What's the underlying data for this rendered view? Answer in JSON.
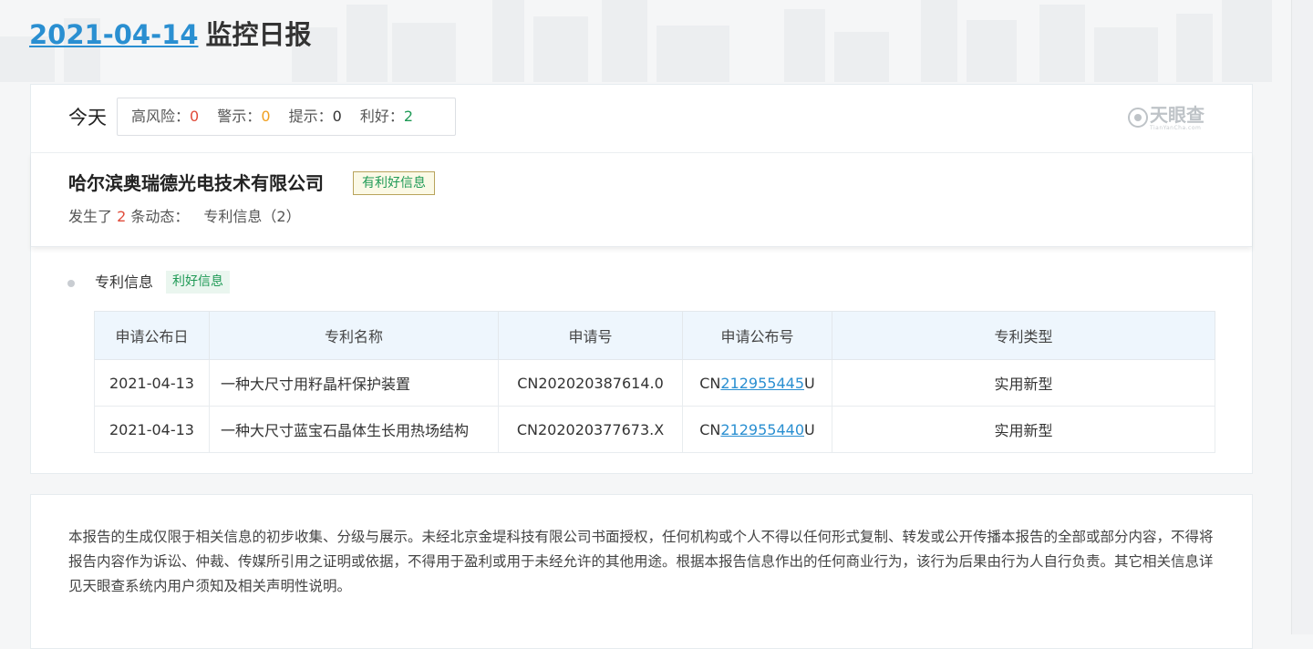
{
  "header": {
    "date": "2021-04-14",
    "title": "监控日报"
  },
  "today": {
    "label": "今天",
    "stats": [
      {
        "label": "高风险：",
        "value": "0",
        "color": "#e04b3a"
      },
      {
        "label": "警示：",
        "value": "0",
        "color": "#f0a020"
      },
      {
        "label": "提示：",
        "value": "0",
        "color": "#333333"
      },
      {
        "label": "利好：",
        "value": "2",
        "color": "#1f9a56"
      }
    ]
  },
  "logo": {
    "name": "天眼查",
    "sub": "TianYanCha.com"
  },
  "company": {
    "name": "哈尔滨奥瑞德光电技术有限公司",
    "tag": "有利好信息",
    "summary_prefix": "发生了",
    "summary_count": "2",
    "summary_suffix": "条动态：",
    "summary_items": "专利信息（2）"
  },
  "section": {
    "title": "专利信息",
    "tag": "利好信息"
  },
  "table": {
    "columns": [
      "申请公布日",
      "专利名称",
      "申请号",
      "申请公布号",
      "专利类型"
    ],
    "rows": [
      {
        "date": "2021-04-13",
        "name": "一种大尺寸用籽晶杆保护装置",
        "app_no": "CN202020387614.0",
        "pub_prefix": "CN",
        "pub_link": "212955445",
        "pub_suffix": "U",
        "type": "实用新型"
      },
      {
        "date": "2021-04-13",
        "name": "一种大尺寸蓝宝石晶体生长用热场结构",
        "app_no": "CN202020377673.X",
        "pub_prefix": "CN",
        "pub_link": "212955440",
        "pub_suffix": "U",
        "type": "实用新型"
      }
    ]
  },
  "footer": {
    "disclaimer": "本报告的生成仅限于相关信息的初步收集、分级与展示。未经北京金堤科技有限公司书面授权，任何机构或个人不得以任何形式复制、转发或公开传播本报告的全部或部分内容，不得将报告内容作为诉讼、仲裁、传媒所引用之证明或依据，不得用于盈利或用于未经允许的其他用途。根据本报告信息作出的任何商业行为，该行为后果由行为人自行负责。其它相关信息详见天眼查系统内用户须知及相关声明性说明。"
  },
  "colors": {
    "link": "#2a8fd1",
    "good": "#1f9a56",
    "risk": "#e04b3a",
    "warn": "#f0a020"
  }
}
